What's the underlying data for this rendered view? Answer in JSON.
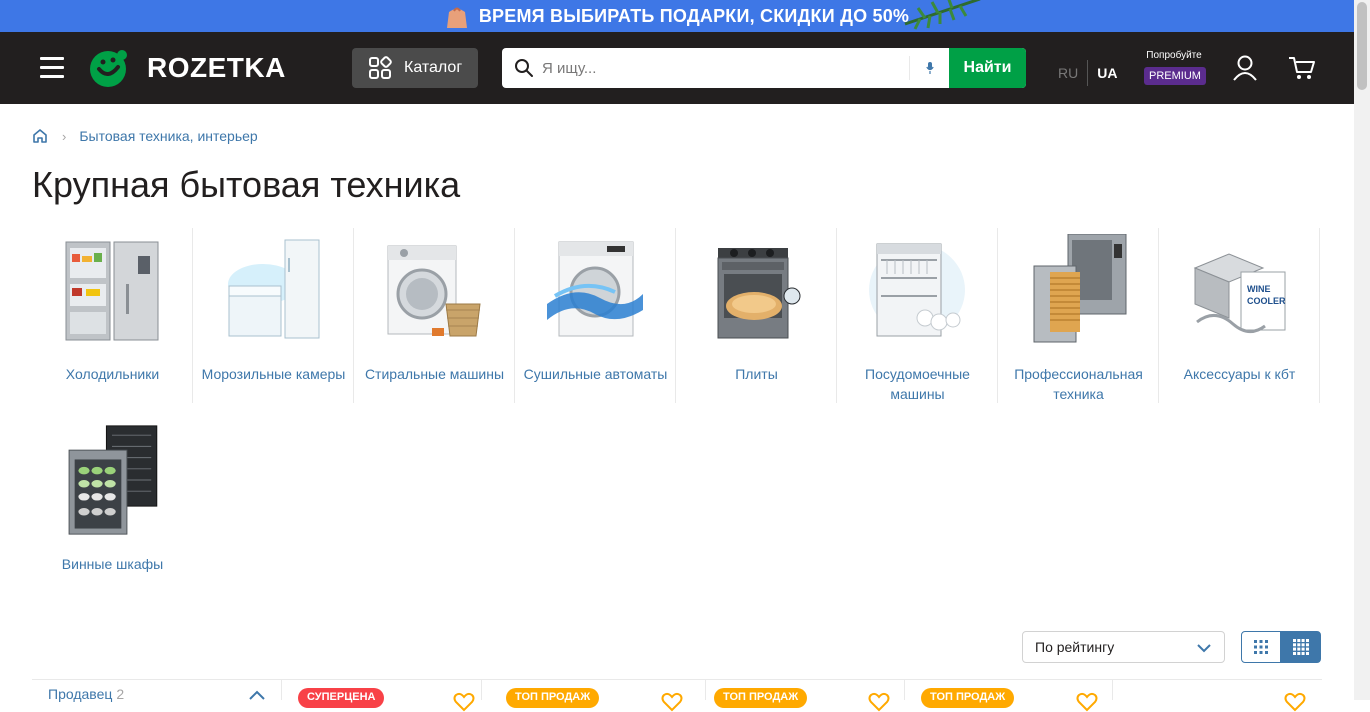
{
  "promo": {
    "text": "ВРЕМЯ ВЫБИРАТЬ ПОДАРКИ, СКИДКИ ДО 50%"
  },
  "header": {
    "logo_text": "ROZETKA",
    "catalog_label": "Каталог",
    "search_placeholder": "Я ищу...",
    "search_button": "Найти",
    "lang_ru": "RU",
    "lang_ua": "UA",
    "premium_try": "Попробуйте",
    "premium_badge": "PREMIUM"
  },
  "breadcrumb": {
    "item": "Бытовая техника, интерьер"
  },
  "page_title": "Крупная бытовая техника",
  "categories": [
    {
      "label": "Холодильники",
      "icon": "fridge"
    },
    {
      "label": "Морозильные камеры",
      "icon": "freezer"
    },
    {
      "label": "Стиральные машины",
      "icon": "washing-machine"
    },
    {
      "label": "Сушильные автоматы",
      "icon": "dryer"
    },
    {
      "label": "Плиты",
      "icon": "stove"
    },
    {
      "label": "Посудомоечные машины",
      "icon": "dishwasher"
    },
    {
      "label": "Профессиональная техника",
      "icon": "professional-oven"
    },
    {
      "label": "Аксессуары к кбт",
      "icon": "accessories"
    },
    {
      "label": "Винные шкафы",
      "icon": "wine-cooler"
    }
  ],
  "sort": {
    "selected": "По рейтингу"
  },
  "filter": {
    "title": "Продавец",
    "count": "2"
  },
  "product_tags": [
    "СУПЕРЦЕНА",
    "ТОП ПРОДАЖ",
    "ТОП ПРОДАЖ",
    "ТОП ПРОДАЖ"
  ],
  "colors": {
    "header": "#221f1f",
    "promo": "#3e77e6",
    "accent_green": "#00a046",
    "link": "#3e77aa",
    "premium": "#5b2c8e"
  }
}
